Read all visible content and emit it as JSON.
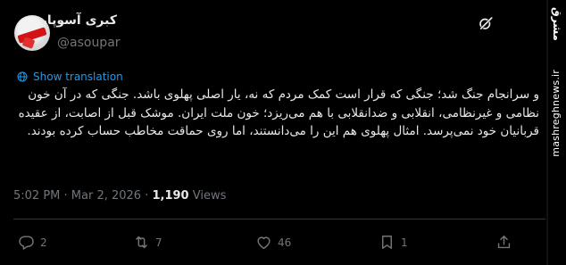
{
  "author": {
    "display_name": "کبری آسوپار",
    "handle": "@asoupar"
  },
  "translate_label": "Show translation",
  "tweet_text": "و سرانجام جنگ شد؛ جنگی که قرار است کمک مردم که نه، یار اصلی پهلوی باشد. جنگی که در آن خون نظامی و غیرنظامی، انقلابی و ضدانقلابی با هم می‌ریزد؛ خون ملت ایران. موشک قبل از اصابت، از عقیده قربانیان خود نمی‌پرسد. امثال پهلوی هم این را می‌دانستند، اما روی حماقت مخاطب حساب کرده بودند.",
  "meta": {
    "time": "5:02 PM",
    "date": "Mar 2, 2026",
    "views_count": "1,190",
    "views_label": "Views"
  },
  "actions": {
    "replies": "2",
    "reposts": "7",
    "likes": "46",
    "bookmarks": "1"
  },
  "watermark": {
    "logo": "مشرق",
    "site": "mashreghnews.ir"
  },
  "colors": {
    "background": "#000000",
    "text": "#e7e9ea",
    "muted": "#71767b",
    "link": "#1d9bf0"
  }
}
